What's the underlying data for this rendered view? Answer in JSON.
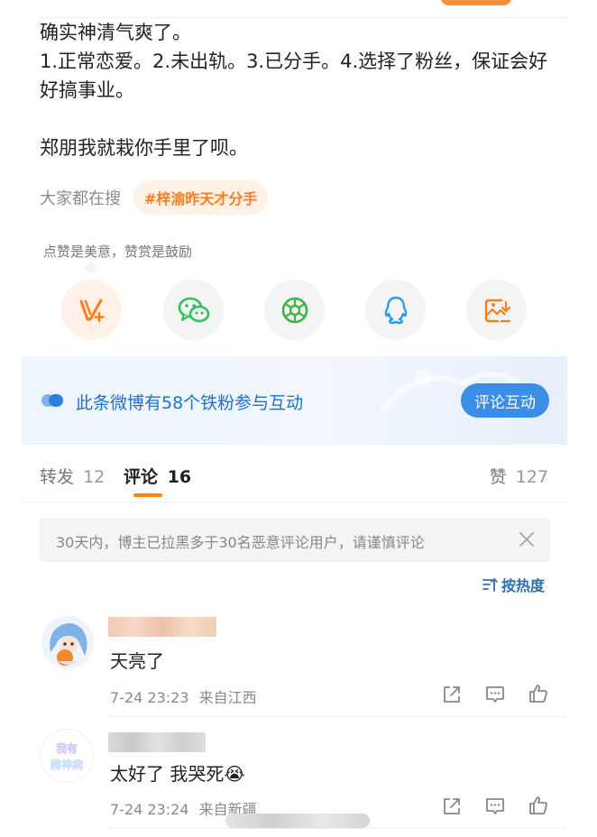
{
  "post": {
    "lines": [
      "确实神清气爽了。",
      "1.正常恋爱。2.未出轨。3.已分手。4.选择了粉丝，保证会好好搞事业。",
      "郑朋我就栽你手里了呗。"
    ]
  },
  "search": {
    "label": "大家都在搜",
    "hashtag": "#梓渝昨天才分手"
  },
  "praise_tip": "点赞是美意，赞赏是鼓励",
  "share_actions": [
    {
      "icon": "tip-v-icon"
    },
    {
      "icon": "wechat-icon"
    },
    {
      "icon": "moments-icon"
    },
    {
      "icon": "qq-icon"
    },
    {
      "icon": "save-image-icon"
    }
  ],
  "banner": {
    "text": "此条微博有58个铁粉参与互动",
    "button": "评论互动"
  },
  "tabs": {
    "repost_label": "转发",
    "repost_count": "12",
    "comment_label": "评论",
    "comment_count": "16",
    "like_label": "赞",
    "like_count": "127"
  },
  "notice": "30天内，博主已拉黑多于30名恶意评论用户，请谨慎评论",
  "sort_label": "按热度",
  "comments": [
    {
      "text": "天亮了",
      "time": "7-24 23:23",
      "source": "来自江西"
    },
    {
      "text": "太好了 我哭死😭",
      "time": "7-24 23:24",
      "source": "来自新疆"
    }
  ],
  "colors": {
    "accent_orange": "#ff8200",
    "link_blue": "#1e6fd9",
    "button_blue": "#3b8ee8",
    "wechat_green": "#2ec15c",
    "moments_green": "#3cb44b",
    "qq_blue": "#2a9af3"
  }
}
